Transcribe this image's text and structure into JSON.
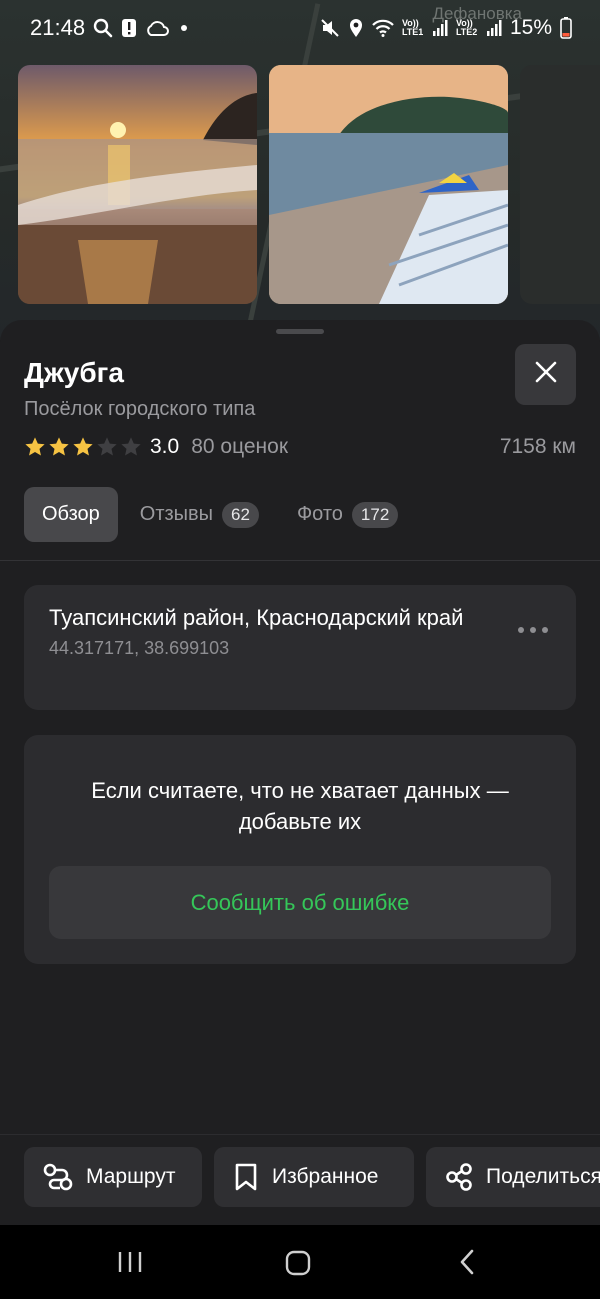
{
  "status_bar": {
    "time": "21:48",
    "battery_percent": "15%",
    "sim1_label": "Vo)) LTE1",
    "sim2_label": "Vo)) LTE2",
    "left_icons": [
      "search-icon",
      "alert-icon",
      "cloud-icon",
      "dot-icon"
    ],
    "right_icons": [
      "mute-icon",
      "location-icon",
      "wifi-icon",
      "signal-icon",
      "signal-icon",
      "battery-icon"
    ]
  },
  "map": {
    "label": "Дефановка"
  },
  "place": {
    "title": "Джубга",
    "subtitle": "Посёлок городского типа",
    "rating": 3.0,
    "rating_text": "3.0",
    "rating_count": "80 оценок",
    "stars_filled": 3,
    "stars_total": 5,
    "distance": "7158 км"
  },
  "tabs": [
    {
      "label": "Обзор",
      "badge": null,
      "active": true
    },
    {
      "label": "Отзывы",
      "badge": "62",
      "active": false
    },
    {
      "label": "Фото",
      "badge": "172",
      "active": false
    }
  ],
  "address": {
    "text": "Туапсинский район, Краснодарский край",
    "coordinates": "44.317171, 38.699103"
  },
  "report": {
    "text": "Если считаете, что не хватает данных — добавьте их",
    "button_label": "Сообщить об ошибке"
  },
  "actions": {
    "route_label": "Маршрут",
    "favorite_label": "Избранное",
    "share_label": "Поделиться"
  },
  "colors": {
    "accent_green": "#35c759",
    "star_gold": "#f6c343",
    "sheet_bg": "#1f1f21",
    "card_bg": "#2c2c2f"
  }
}
